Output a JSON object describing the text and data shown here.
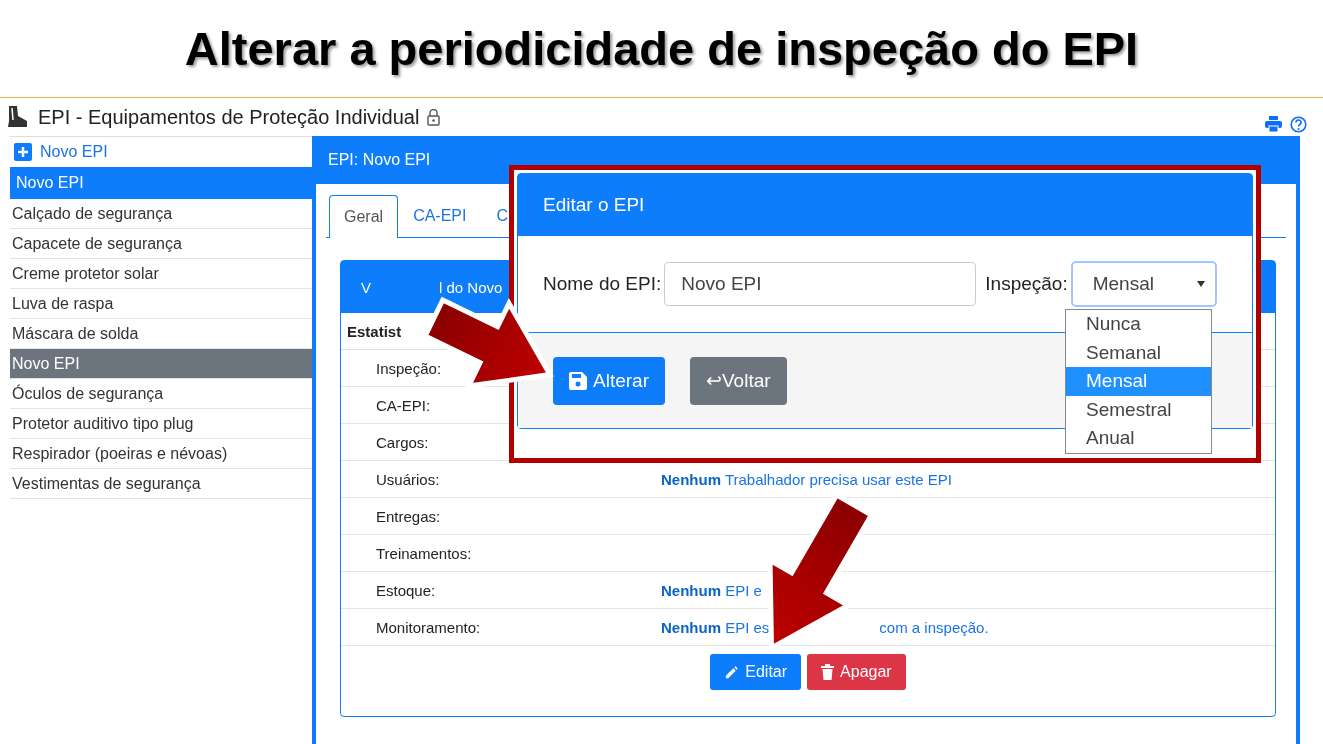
{
  "banner": {
    "title": "Alterar a periodicidade de inspeção do EPI"
  },
  "header": {
    "title": "EPI - Equipamentos de Proteção Individual"
  },
  "sidebar": {
    "add_link": "Novo EPI",
    "heading": "Novo EPI",
    "items": [
      {
        "label": "Calçado de segurança",
        "selected": false
      },
      {
        "label": "Capacete de segurança",
        "selected": false
      },
      {
        "label": "Creme protetor solar",
        "selected": false
      },
      {
        "label": "Luva de raspa",
        "selected": false
      },
      {
        "label": "Máscara de solda",
        "selected": false
      },
      {
        "label": "Novo EPI",
        "selected": true
      },
      {
        "label": "Óculos de segurança",
        "selected": false
      },
      {
        "label": "Protetor auditivo tipo plug",
        "selected": false
      },
      {
        "label": "Respirador (poeiras e névoas)",
        "selected": false
      },
      {
        "label": "Vestimentas de segurança",
        "selected": false
      }
    ]
  },
  "panel": {
    "title": "EPI: Novo EPI",
    "tabs": [
      {
        "label": "Geral",
        "selected": true
      },
      {
        "label": "CA-EPI",
        "selected": false
      },
      {
        "label": "C",
        "selected": false
      }
    ],
    "card": {
      "header_parts": [
        "V",
        "l do Novo"
      ],
      "section": "Estatist",
      "rows": [
        {
          "label": "Inspeção:",
          "values": []
        },
        {
          "label": "CA-EPI:",
          "values": []
        },
        {
          "label": "Cargos:",
          "values": []
        },
        {
          "label": "Usuários:",
          "values": [
            "**Nenhum** Trabalhador precisa usar este EPI"
          ]
        },
        {
          "label": "Entregas:",
          "values": []
        },
        {
          "label": "Treinamentos:",
          "values": []
        },
        {
          "label": "Estoque:",
          "values": [
            "**Nenhum** EPI e"
          ]
        },
        {
          "label": "Monitoramento:",
          "values": [
            "**Nenhum** EPI es",
            "com a inspeção."
          ]
        }
      ],
      "buttons": [
        {
          "label": "Editar",
          "kind": "edit"
        },
        {
          "label": "Apagar",
          "kind": "delete"
        }
      ]
    }
  },
  "modal": {
    "title": "Editar o EPI",
    "name_label": "Nome do EPI:",
    "name_value": "Novo EPI",
    "inspection_label": "Inspeção:",
    "inspection_value": "Mensal",
    "options": [
      {
        "label": "Nunca",
        "selected": false
      },
      {
        "label": "Semanal",
        "selected": false
      },
      {
        "label": "Mensal",
        "selected": true
      },
      {
        "label": "Semestral",
        "selected": false
      },
      {
        "label": "Anual",
        "selected": false
      }
    ],
    "buttons": [
      {
        "label": "Alterar",
        "kind": "save"
      },
      {
        "label": "↩Voltar",
        "kind": "back"
      }
    ]
  }
}
